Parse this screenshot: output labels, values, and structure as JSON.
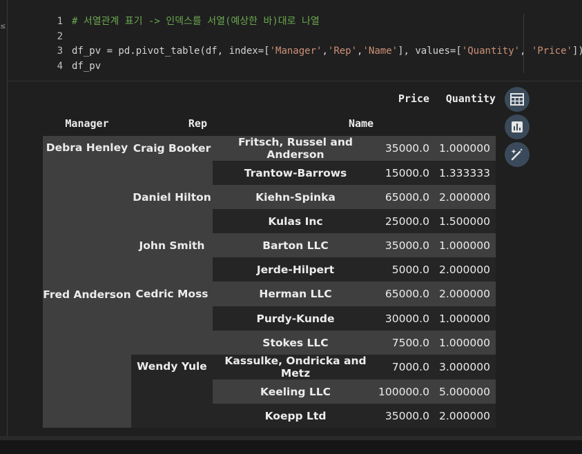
{
  "code": {
    "lines": [
      {
        "no": "1",
        "comment": "# 서열관계 표기 -> 인덱스를 서열(예상한 바)대로 나열"
      },
      {
        "no": "2"
      },
      {
        "no": "3",
        "p1": "df_pv = pd.pivot_table(df, index=",
        "b1": "[",
        "s1": "'Manager'",
        "c1": ",",
        "s2": "'Rep'",
        "c2": ",",
        "s3": "'Name'",
        "b2": "]",
        "p2": ", values=",
        "b3": "[",
        "s4": "'Quantity'",
        "c3": ", ",
        "s5": "'Price'",
        "b4": "]",
        "p3": ")"
      },
      {
        "no": "4",
        "p1": "df_pv"
      }
    ]
  },
  "table": {
    "columns": [
      "Price",
      "Quantity"
    ],
    "index_names": [
      "Manager",
      "Rep",
      "Name"
    ],
    "rows": [
      {
        "manager": "Debra Henley",
        "rep": "Craig Booker",
        "name": "Fritsch, Russel and Anderson",
        "price": "35000.0",
        "quantity": "1.000000"
      },
      {
        "manager": "",
        "rep": "",
        "name": "Trantow-Barrows",
        "price": "15000.0",
        "quantity": "1.333333"
      },
      {
        "manager": "",
        "rep": "Daniel Hilton",
        "name": "Kiehn-Spinka",
        "price": "65000.0",
        "quantity": "2.000000"
      },
      {
        "manager": "",
        "rep": "",
        "name": "Kulas Inc",
        "price": "25000.0",
        "quantity": "1.500000"
      },
      {
        "manager": "",
        "rep": "John Smith",
        "name": "Barton LLC",
        "price": "35000.0",
        "quantity": "1.000000"
      },
      {
        "manager": "",
        "rep": "",
        "name": "Jerde-Hilpert",
        "price": "5000.0",
        "quantity": "2.000000"
      },
      {
        "manager": "Fred Anderson",
        "rep": "Cedric Moss",
        "name": "Herman LLC",
        "price": "65000.0",
        "quantity": "2.000000"
      },
      {
        "manager": "",
        "rep": "",
        "name": "Purdy-Kunde",
        "price": "30000.0",
        "quantity": "1.000000"
      },
      {
        "manager": "",
        "rep": "",
        "name": "Stokes LLC",
        "price": "7500.0",
        "quantity": "1.000000"
      },
      {
        "manager": "",
        "rep": "Wendy Yule",
        "name": "Kassulke, Ondricka and Metz",
        "price": "7000.0",
        "quantity": "3.000000"
      },
      {
        "manager": "",
        "rep": "",
        "name": "Keeling LLC",
        "price": "100000.0",
        "quantity": "5.000000"
      },
      {
        "manager": "",
        "rep": "",
        "name": "Koepp Ltd",
        "price": "35000.0",
        "quantity": "2.000000"
      }
    ]
  },
  "side_buttons": [
    {
      "icon": "table-icon"
    },
    {
      "icon": "bar-chart-icon"
    },
    {
      "icon": "magic-wand-icon"
    }
  ],
  "left_glyph": "≤"
}
